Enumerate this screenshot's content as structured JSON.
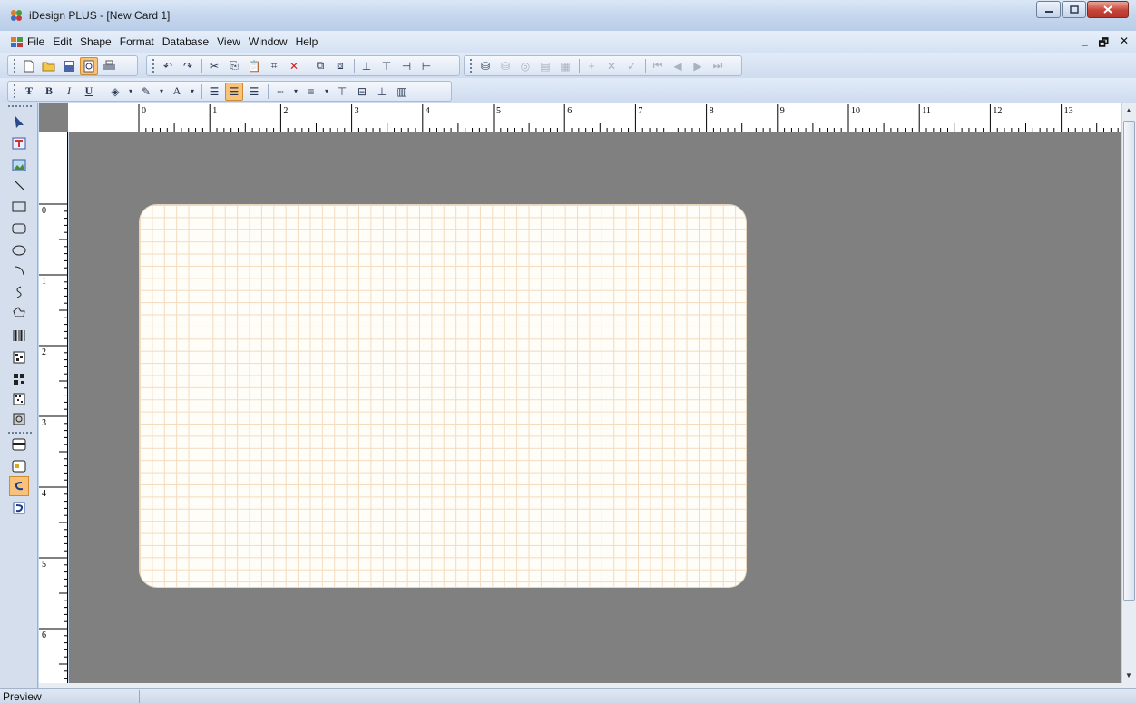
{
  "window": {
    "title": "iDesign PLUS - [New Card 1]"
  },
  "menu": {
    "items": [
      "File",
      "Edit",
      "Shape",
      "Format",
      "Database",
      "View",
      "Window",
      "Help"
    ]
  },
  "format_toolbar": {
    "font_label": "A",
    "bold": "B",
    "italic": "I",
    "underline": "U"
  },
  "ruler": {
    "horizontal_labels": [
      "0",
      "1",
      "2",
      "3",
      "4",
      "5",
      "6",
      "7",
      "8",
      "9",
      "10",
      "11",
      "12",
      "13"
    ],
    "vertical_labels": [
      "0",
      "1",
      "2",
      "3",
      "4",
      "5",
      "6"
    ]
  },
  "statusbar": {
    "text": "Preview"
  },
  "colors": {
    "workspace": "#808080",
    "card": "#fffdf7",
    "grid": "#f3dbbf",
    "active_tool": "#f8c27a"
  }
}
